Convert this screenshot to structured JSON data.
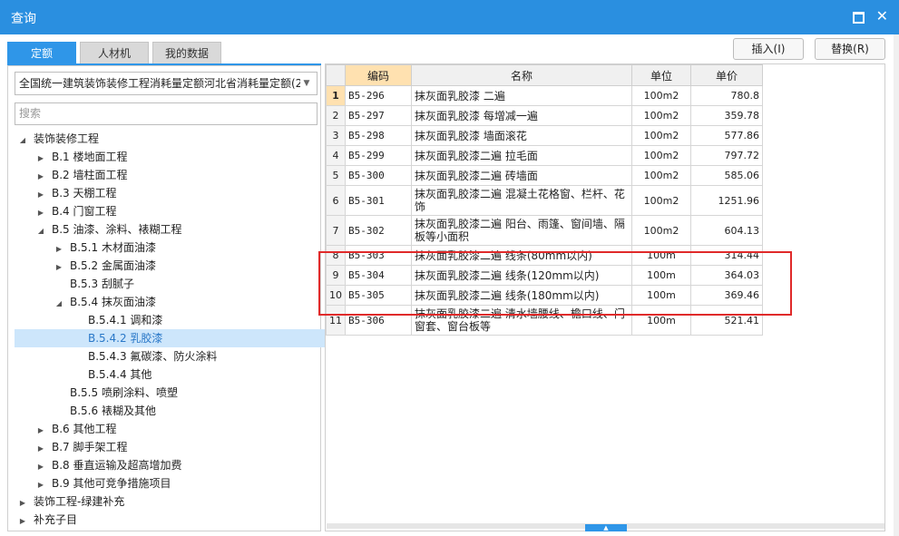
{
  "window": {
    "title": "查询"
  },
  "tabs": [
    "定额",
    "人材机",
    "我的数据"
  ],
  "buttons": {
    "insert": "插入(I)",
    "replace": "替换(R)"
  },
  "left": {
    "selected_library": "全国统一建筑装饰装修工程消耗量定额河北省消耗量定额(2(",
    "search_placeholder": "搜索",
    "tree": [
      {
        "label": "装饰装修工程",
        "level": 0,
        "toggle": "open"
      },
      {
        "label": "B.1 楼地面工程",
        "level": 1,
        "toggle": "closed"
      },
      {
        "label": "B.2 墙柱面工程",
        "level": 1,
        "toggle": "closed"
      },
      {
        "label": "B.3 天棚工程",
        "level": 1,
        "toggle": "closed"
      },
      {
        "label": "B.4 门窗工程",
        "level": 1,
        "toggle": "closed"
      },
      {
        "label": "B.5 油漆、涂料、裱糊工程",
        "level": 1,
        "toggle": "open"
      },
      {
        "label": "B.5.1 木材面油漆",
        "level": 2,
        "toggle": "closed"
      },
      {
        "label": "B.5.2 金属面油漆",
        "level": 2,
        "toggle": "closed"
      },
      {
        "label": "B.5.3 刮腻子",
        "level": 2,
        "toggle": "none"
      },
      {
        "label": "B.5.4 抹灰面油漆",
        "level": 2,
        "toggle": "open"
      },
      {
        "label": "B.5.4.1 调和漆",
        "level": 3,
        "toggle": "none"
      },
      {
        "label": "B.5.4.2 乳胶漆",
        "level": 3,
        "toggle": "none",
        "selected": true
      },
      {
        "label": "B.5.4.3 氟碳漆、防火涂料",
        "level": 3,
        "toggle": "none"
      },
      {
        "label": "B.5.4.4 其他",
        "level": 3,
        "toggle": "none"
      },
      {
        "label": "B.5.5 喷刷涂料、喷塑",
        "level": 2,
        "toggle": "none"
      },
      {
        "label": "B.5.6 裱糊及其他",
        "level": 2,
        "toggle": "none"
      },
      {
        "label": "B.6 其他工程",
        "level": 1,
        "toggle": "closed"
      },
      {
        "label": "B.7 脚手架工程",
        "level": 1,
        "toggle": "closed"
      },
      {
        "label": "B.8 垂直运输及超高增加费",
        "level": 1,
        "toggle": "closed"
      },
      {
        "label": "B.9 其他可竞争措施项目",
        "level": 1,
        "toggle": "closed"
      },
      {
        "label": "装饰工程-绿建补充",
        "level": 0,
        "toggle": "closed"
      },
      {
        "label": "补充子目",
        "level": 0,
        "toggle": "closed"
      }
    ]
  },
  "table": {
    "columns": [
      "编码",
      "名称",
      "单位",
      "单价"
    ],
    "rows": [
      {
        "idx": "1",
        "code": "B5-296",
        "name": "抹灰面乳胶漆 二遍",
        "unit": "100m2",
        "price": "780.8"
      },
      {
        "idx": "2",
        "code": "B5-297",
        "name": "抹灰面乳胶漆 每增减一遍",
        "unit": "100m2",
        "price": "359.78"
      },
      {
        "idx": "3",
        "code": "B5-298",
        "name": "抹灰面乳胶漆 墙面滚花",
        "unit": "100m2",
        "price": "577.86"
      },
      {
        "idx": "4",
        "code": "B5-299",
        "name": "抹灰面乳胶漆二遍 拉毛面",
        "unit": "100m2",
        "price": "797.72"
      },
      {
        "idx": "5",
        "code": "B5-300",
        "name": "抹灰面乳胶漆二遍 砖墙面",
        "unit": "100m2",
        "price": "585.06"
      },
      {
        "idx": "6",
        "code": "B5-301",
        "name": "抹灰面乳胶漆二遍 混凝土花格窗、栏杆、花饰",
        "unit": "100m2",
        "price": "1251.96"
      },
      {
        "idx": "7",
        "code": "B5-302",
        "name": "抹灰面乳胶漆二遍 阳台、雨篷、窗间墙、隔板等小面积",
        "unit": "100m2",
        "price": "604.13"
      },
      {
        "idx": "8",
        "code": "B5-303",
        "name": "抹灰面乳胶漆二遍 线条(80mm以内)",
        "unit": "100m",
        "price": "314.44"
      },
      {
        "idx": "9",
        "code": "B5-304",
        "name": "抹灰面乳胶漆二遍 线条(120mm以内)",
        "unit": "100m",
        "price": "364.03"
      },
      {
        "idx": "10",
        "code": "B5-305",
        "name": "抹灰面乳胶漆二遍 线条(180mm以内)",
        "unit": "100m",
        "price": "369.46"
      },
      {
        "idx": "11",
        "code": "B5-306",
        "name": "抹灰面乳胶漆二遍 清水墙腰线、檐口线、门窗套、窗台板等",
        "unit": "100m",
        "price": "521.41"
      }
    ]
  },
  "colors": {
    "titlebar": "#2a8fe0",
    "accent": "#2f96e8",
    "highlight_border": "#e02a2a"
  }
}
